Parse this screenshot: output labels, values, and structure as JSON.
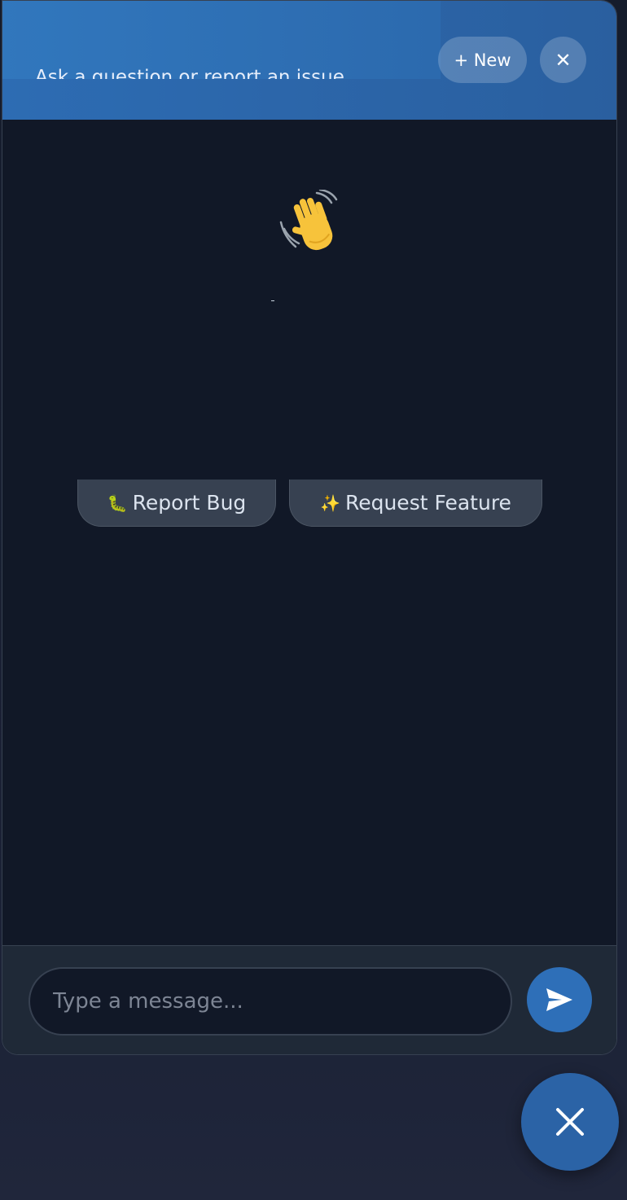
{
  "header": {
    "subtitle": "Ask a question or report an issue",
    "new_label": "+ New",
    "close_label": "✕"
  },
  "welcome": {
    "emoji": "👋"
  },
  "quick_actions": [
    {
      "emoji": "🐛",
      "label": "Report Bug"
    },
    {
      "emoji": "✨",
      "label": "Request Feature"
    }
  ],
  "composer": {
    "placeholder": "Type a message..."
  },
  "icons": {
    "send": "send-icon",
    "launcher": "close-icon",
    "wave": "waving-hand-icon"
  },
  "colors": {
    "header_bg": "#2d6cb3",
    "panel_bg": "#111827",
    "footer_bg": "#1f2937",
    "accent": "#2e6fb8"
  }
}
